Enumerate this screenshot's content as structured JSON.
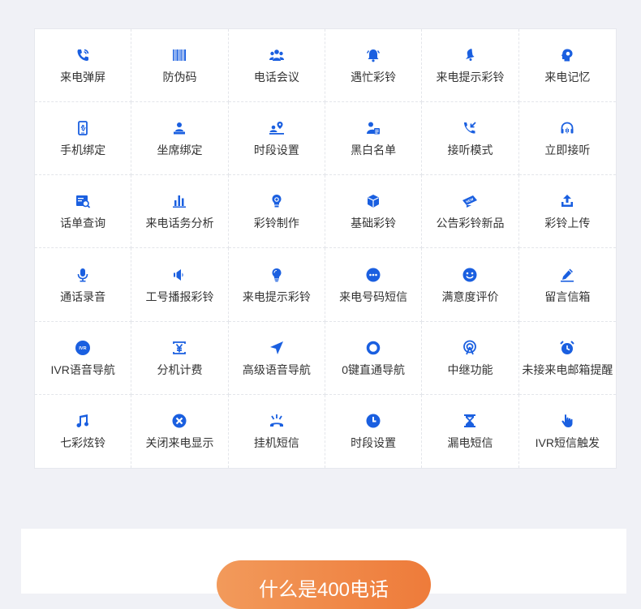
{
  "accent_color": "#1a5fe0",
  "cta_color": "#ef8a4a",
  "features": [
    {
      "label": "来电弹屏",
      "icon": "phone-ringing-icon"
    },
    {
      "label": "防伪码",
      "icon": "barcode-icon"
    },
    {
      "label": "电话会议",
      "icon": "group-icon"
    },
    {
      "label": "遇忙彩铃",
      "icon": "bell-icon"
    },
    {
      "label": "来电提示彩铃",
      "icon": "ringing-bell-icon"
    },
    {
      "label": "来电记忆",
      "icon": "head-memory-icon"
    },
    {
      "label": "手机绑定",
      "icon": "mobile-link-icon"
    },
    {
      "label": "坐席绑定",
      "icon": "agent-desk-icon"
    },
    {
      "label": "时段设置",
      "icon": "person-location-icon"
    },
    {
      "label": "黑白名单",
      "icon": "contact-list-icon"
    },
    {
      "label": "接听模式",
      "icon": "incoming-call-icon"
    },
    {
      "label": "立即接听",
      "icon": "headset-icon"
    },
    {
      "label": "话单查询",
      "icon": "bill-search-icon"
    },
    {
      "label": "来电话务分析",
      "icon": "bar-chart-icon"
    },
    {
      "label": "彩铃制作",
      "icon": "lightbulb-gear-icon"
    },
    {
      "label": "基础彩铃",
      "icon": "cube-icon"
    },
    {
      "label": "公告彩铃新品",
      "icon": "new-badge-icon"
    },
    {
      "label": "彩铃上传",
      "icon": "upload-icon"
    },
    {
      "label": "通话录音",
      "icon": "microphone-icon"
    },
    {
      "label": "工号播报彩铃",
      "icon": "speaker-icon"
    },
    {
      "label": "来电提示彩铃",
      "icon": "lightbulb-icon"
    },
    {
      "label": "来电号码短信",
      "icon": "chat-dots-icon"
    },
    {
      "label": "满意度评价",
      "icon": "smiley-icon"
    },
    {
      "label": "留言信箱",
      "icon": "pencil-icon"
    },
    {
      "label": "IVR语音导航",
      "icon": "ivr-badge-icon",
      "badge": "IVR"
    },
    {
      "label": "分机计费",
      "icon": "yen-icon"
    },
    {
      "label": "高级语音导航",
      "icon": "navigation-arrow-icon"
    },
    {
      "label": "0键直通导航",
      "icon": "ring-icon"
    },
    {
      "label": "中继功能",
      "icon": "broadcast-icon"
    },
    {
      "label": "未接来电邮箱提醒",
      "icon": "alarm-clock-icon"
    },
    {
      "label": "七彩炫铃",
      "icon": "music-note-icon"
    },
    {
      "label": "关闭来电显示",
      "icon": "close-circle-icon"
    },
    {
      "label": "挂机短信",
      "icon": "hang-up-icon"
    },
    {
      "label": "时段设置",
      "icon": "clock-icon"
    },
    {
      "label": "漏电短信",
      "icon": "hourglass-icon"
    },
    {
      "label": "IVR短信触发",
      "icon": "tap-hand-icon"
    }
  ],
  "cta": {
    "label": "什么是400电话"
  }
}
